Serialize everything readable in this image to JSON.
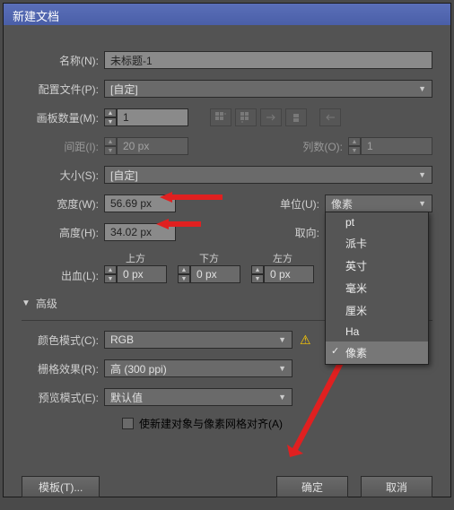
{
  "title": "新建文档",
  "name": {
    "label": "名称(N):",
    "value": "未标题-1"
  },
  "profile": {
    "label": "配置文件(P):",
    "value": "[自定]"
  },
  "artboards": {
    "label": "画板数量(M):",
    "value": "1"
  },
  "spacing": {
    "label": "间距(I):",
    "value": "20 px"
  },
  "cols": {
    "label": "列数(O):",
    "value": "1"
  },
  "size": {
    "label": "大小(S):",
    "value": "[自定]"
  },
  "width": {
    "label": "宽度(W):",
    "value": "56.69 px"
  },
  "height": {
    "label": "高度(H):",
    "value": "34.02 px"
  },
  "units": {
    "label": "单位(U):",
    "value": "像素",
    "options": [
      "pt",
      "派卡",
      "英寸",
      "毫米",
      "厘米",
      "Ha",
      "像素"
    ],
    "selected": "像素"
  },
  "orient": {
    "label": "取向:"
  },
  "bleed": {
    "label": "出血(L):",
    "top": "上方",
    "bottom": "下方",
    "left": "左方",
    "val": "0 px"
  },
  "advanced": "高级",
  "colormode": {
    "label": "颜色模式(C):",
    "value": "RGB"
  },
  "raster": {
    "label": "栅格效果(R):",
    "value": "高 (300 ppi)"
  },
  "preview": {
    "label": "预览模式(E):",
    "value": "默认值"
  },
  "align": "使新建对象与像素网格对齐(A)",
  "buttons": {
    "template": "模板(T)...",
    "ok": "确定",
    "cancel": "取消"
  }
}
